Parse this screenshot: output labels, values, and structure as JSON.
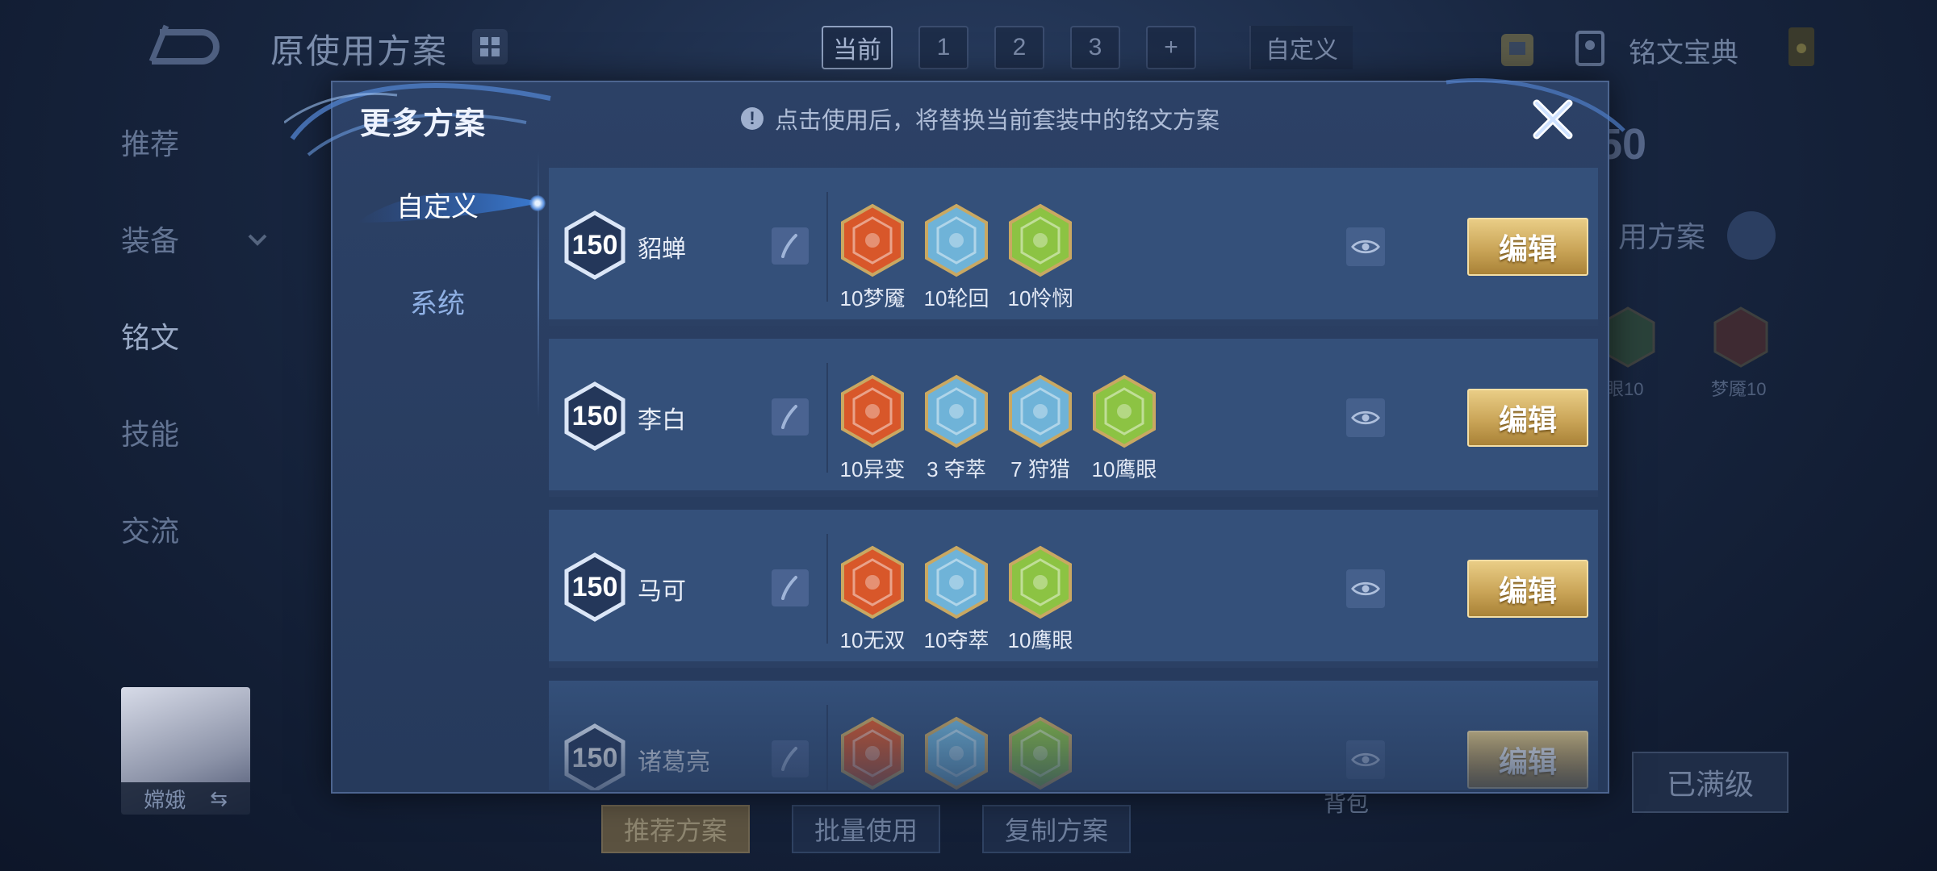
{
  "background": {
    "page_title": "原使用方案",
    "tabs": [
      "当前",
      "1",
      "2",
      "3",
      "+"
    ],
    "tab_custom": "自定义",
    "codex_label": "铭文宝典",
    "side_nav": [
      "推荐",
      "装备",
      "铭文",
      "技能",
      "交流"
    ],
    "hero_name": "嫦娥",
    "right_card_level": "50",
    "right_card_text": "用方案",
    "bg_rune_labels": [
      "眼10",
      "梦魇10"
    ],
    "bottom_buttons": [
      "推荐方案",
      "批量使用",
      "复制方案"
    ],
    "bag_label": "背包",
    "maxed_label": "已满级"
  },
  "modal": {
    "title": "更多方案",
    "tip": "点击使用后，将替换当前套装中的铭文方案",
    "left_tabs": [
      "自定义",
      "系统"
    ],
    "edit_label": "编辑",
    "rows": [
      {
        "level": "150",
        "hero": "貂蝉",
        "runes": [
          {
            "label": "10梦魇",
            "color": "red",
            "icon": "red-rune-icon"
          },
          {
            "label": "10轮回",
            "color": "blue",
            "icon": "swirl-rune-icon"
          },
          {
            "label": "10怜悯",
            "color": "green",
            "icon": "green-rune-icon"
          }
        ]
      },
      {
        "level": "150",
        "hero": "李白",
        "runes": [
          {
            "label": "10异变",
            "color": "red",
            "icon": "red-rune-icon"
          },
          {
            "label": "3 夺萃",
            "color": "blue",
            "icon": "blue-rune-icon"
          },
          {
            "label": "7 狩猎",
            "color": "blue",
            "icon": "lightning-rune-icon"
          },
          {
            "label": "10鹰眼",
            "color": "green",
            "icon": "green-rune-icon"
          }
        ]
      },
      {
        "level": "150",
        "hero": "马可",
        "runes": [
          {
            "label": "10无双",
            "color": "red",
            "icon": "red-rune-icon"
          },
          {
            "label": "10夺萃",
            "color": "blue",
            "icon": "blue-rune-icon"
          },
          {
            "label": "10鹰眼",
            "color": "green",
            "icon": "green-rune-icon"
          }
        ]
      },
      {
        "level": "150",
        "hero": "诸葛亮",
        "runes": [
          {
            "label": "",
            "color": "red",
            "icon": "red-rune-icon"
          },
          {
            "label": "",
            "color": "blue",
            "icon": "lightning-rune-icon"
          },
          {
            "label": "",
            "color": "green",
            "icon": "green-rune-icon"
          }
        ]
      }
    ]
  },
  "colors": {
    "rune_red": "#d8572a",
    "rune_blue": "#6fb3d8",
    "rune_green": "#8cc343",
    "rune_frame": "#c9a862",
    "edit_gold": "#caa558"
  }
}
